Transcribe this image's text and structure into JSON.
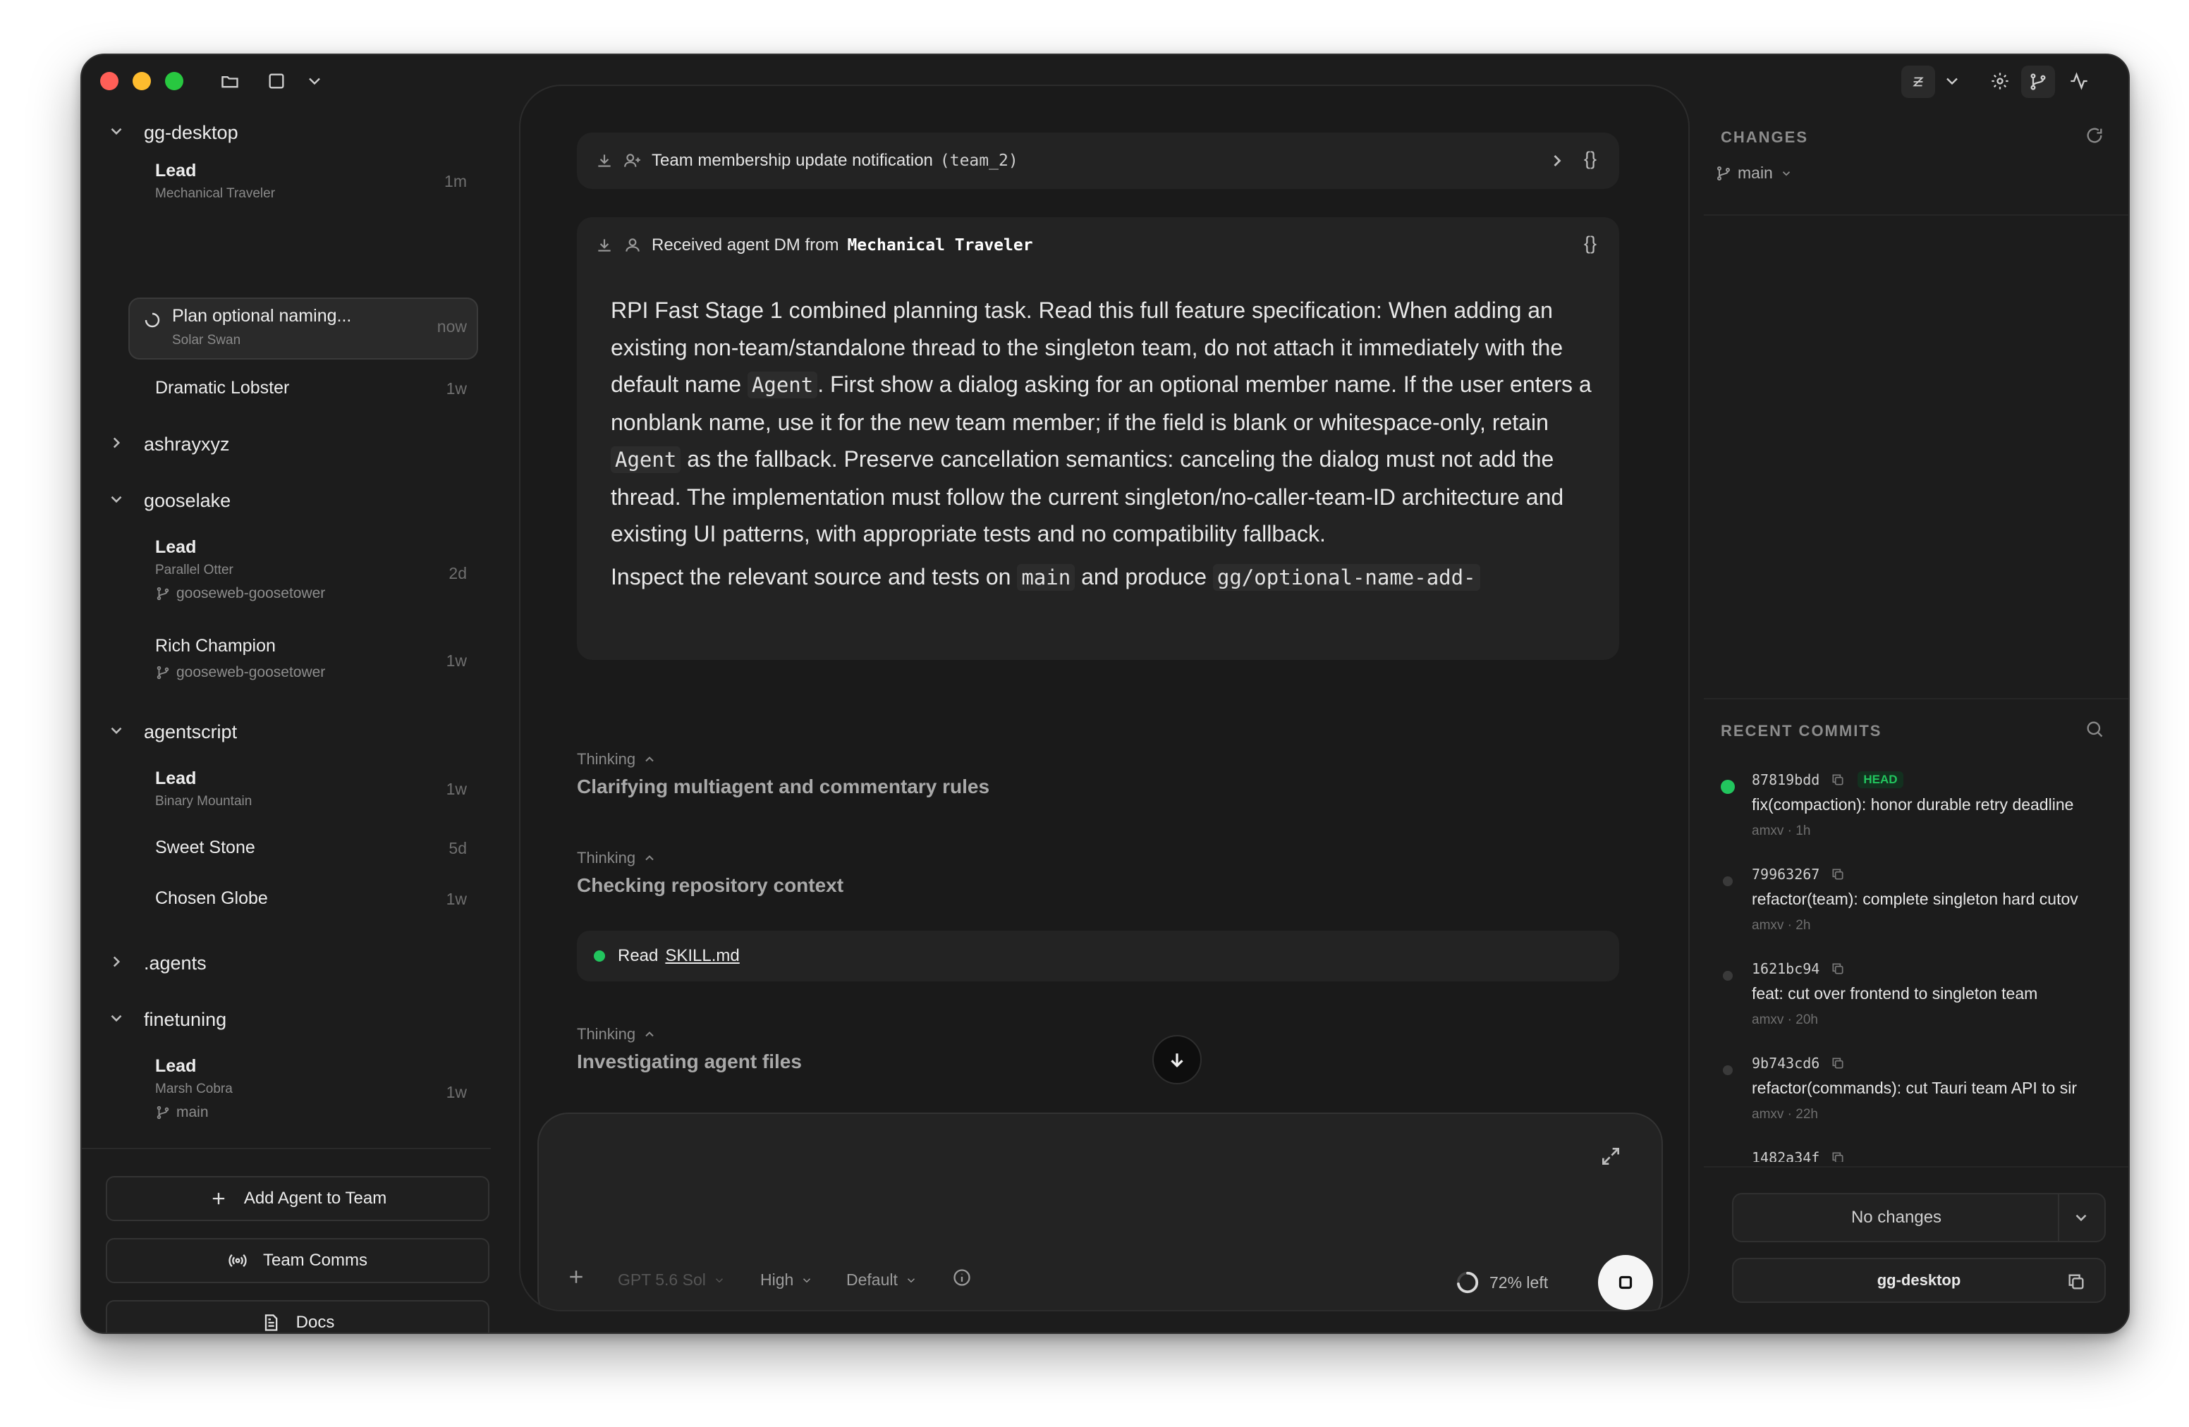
{
  "sidebar": {
    "groups": [
      {
        "name": "gg-desktop",
        "expanded": true
      },
      {
        "name": "ashrayxyz",
        "expanded": false
      },
      {
        "name": "gooselake",
        "expanded": true
      },
      {
        "name": "agentscript",
        "expanded": true
      },
      {
        "name": ".agents",
        "expanded": false
      },
      {
        "name": "finetuning",
        "expanded": true
      }
    ],
    "threads": [
      {
        "title": "Lead",
        "subtitle": "Mechanical Traveler",
        "time": "1m"
      },
      {
        "title": "Plan optional naming...",
        "subtitle": "Solar Swan",
        "time": "now"
      },
      {
        "title": "Dramatic Lobster",
        "time": "1w"
      },
      {
        "title": "Lead",
        "subtitle": "Parallel Otter",
        "branch": "gooseweb-goosetower",
        "time": "2d"
      },
      {
        "title": "Rich Champion",
        "branch": "gooseweb-goosetower",
        "time": "1w"
      },
      {
        "title": "Lead",
        "subtitle": "Binary Mountain",
        "time": "1w"
      },
      {
        "title": "Sweet Stone",
        "time": "5d"
      },
      {
        "title": "Chosen Globe",
        "time": "1w"
      },
      {
        "title": "Lead",
        "subtitle": "Marsh Cobra",
        "branch": "main",
        "time": "1w"
      }
    ],
    "buttons": {
      "add_agent": "Add Agent to Team",
      "team_comms": "Team Comms",
      "docs": "Docs"
    }
  },
  "main": {
    "notification": {
      "label": "Team membership update notification",
      "code": "(team_2)",
      "braces": "{}"
    },
    "dm": {
      "prefix": "Received agent DM from",
      "sender": "Mechanical Traveler",
      "braces": "{}",
      "body_1a": "RPI Fast Stage 1 combined planning task. Read this full feature specification: When adding an existing non-team/standalone thread to the singleton team, do not attach it immediately with the default name",
      "code_agent": "Agent",
      "body_1b": ". First show a dialog asking for an optional member name. If the user enters a nonblank name, use it for the new team member; if the field is blank or whitespace-only, retain",
      "body_1c": "as the fallback. Preserve cancellation semantics: canceling the dialog must not add the thread. The implementation must follow the current singleton/no-caller-team-ID architecture and existing UI patterns, with appropriate tests and no compatibility fallback.",
      "body_2a": "Inspect the relevant source and tests on",
      "code_main": "main",
      "body_2b": "and produce",
      "code_output": "gg/optional-name-add-"
    },
    "thinking": [
      {
        "label": "Thinking",
        "text": "Clarifying multiagent and commentary rules"
      },
      {
        "label": "Thinking",
        "text": "Checking repository context"
      },
      {
        "label": "Thinking",
        "text": "Investigating agent files"
      }
    ],
    "read": {
      "verb": "Read",
      "file": "SKILL.md"
    },
    "composer": {
      "model": "GPT 5.6 Sol",
      "effort": "High",
      "mode": "Default",
      "context": "72% left",
      "context_used_fraction": 0.28
    }
  },
  "right_panel": {
    "changes_title": "CHANGES",
    "branch": "main",
    "recent_commits_title": "RECENT COMMITS",
    "commits": [
      {
        "hash": "87819bdd",
        "head": "HEAD",
        "message": "fix(compaction): honor durable retry deadline",
        "meta": "amxv · 1h"
      },
      {
        "hash": "79963267",
        "message": "refactor(team): complete singleton hard cutov",
        "meta": "amxv · 2h"
      },
      {
        "hash": "1621bc94",
        "message": "feat: cut over frontend to singleton team",
        "meta": "amxv · 20h"
      },
      {
        "hash": "9b743cd6",
        "message": "refactor(commands): cut Tauri team API to sir",
        "meta": "amxv · 22h"
      },
      {
        "hash": "1482a34f"
      }
    ],
    "no_changes": "No changes",
    "repo": "gg-desktop"
  },
  "colors": {
    "window_bg": "#1c1c1c",
    "accent_green": "#22c55e",
    "traffic_red": "#ff5f57",
    "traffic_yellow": "#febc2e",
    "traffic_green": "#28c840"
  }
}
